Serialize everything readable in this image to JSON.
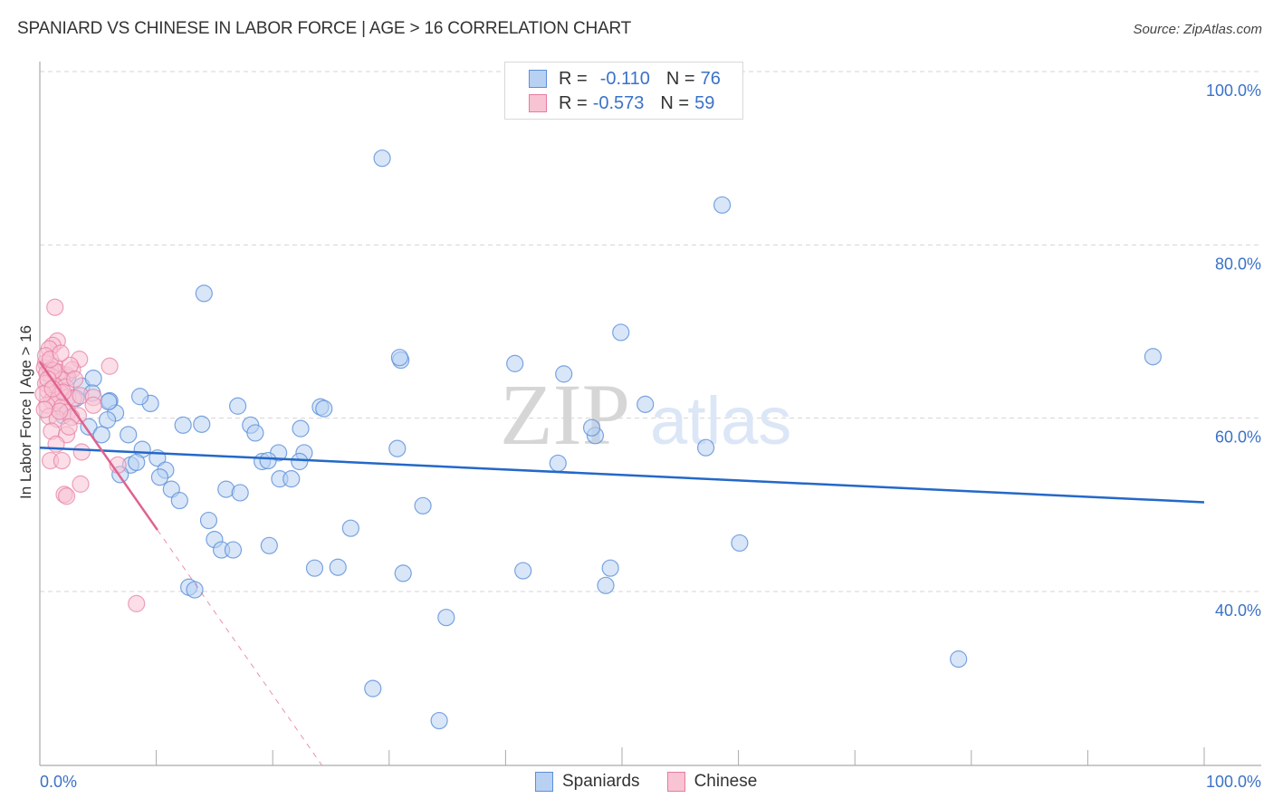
{
  "header": {
    "title": "SPANIARD VS CHINESE IN LABOR FORCE | AGE > 16 CORRELATION CHART",
    "source": "Source: ZipAtlas.com"
  },
  "legend": {
    "rows": [
      {
        "series": "Spaniards",
        "r_label": "R =",
        "r_value": "-0.110",
        "n_label": "N =",
        "n_value": "76"
      },
      {
        "series": "Chinese",
        "r_label": "R =",
        "r_value": "-0.573",
        "n_label": "N =",
        "n_value": "59"
      }
    ]
  },
  "bottom_legend": [
    "Spaniards",
    "Chinese"
  ],
  "watermark": {
    "zip": "ZIP",
    "atlas": "atlas"
  },
  "colors": {
    "spaniards_fill": "#b8d1f3",
    "spaniards_stroke": "#5b8fd9",
    "spaniards_line": "#2468c8",
    "chinese_fill": "#f8c3d3",
    "chinese_stroke": "#e57ca0",
    "chinese_line": "#e0628f",
    "axis_text": "#3a72c8"
  },
  "chart_data": {
    "type": "scatter",
    "title": "SPANIARD VS CHINESE IN LABOR FORCE | AGE > 16 CORRELATION CHART",
    "xlabel": "",
    "ylabel": "In Labor Force | Age > 16",
    "xlim": [
      0,
      100
    ],
    "ylim": [
      21.5,
      102.3
    ],
    "x_tick_labels": [
      "0.0%",
      "100.0%"
    ],
    "y_ticks": [
      40,
      60,
      80,
      100
    ],
    "y_tick_labels": [
      "40.0%",
      "60.0%",
      "80.0%",
      "100.0%"
    ],
    "grid": true,
    "legend_position": "top-center",
    "series": [
      {
        "name": "Spaniards",
        "R": -0.11,
        "N": 76,
        "trend": {
          "x": [
            0,
            100
          ],
          "y": [
            56.6,
            50.3
          ]
        },
        "points": [
          [
            29.4,
            90.0
          ],
          [
            58.6,
            84.6
          ],
          [
            14.1,
            74.4
          ],
          [
            49.9,
            69.9
          ],
          [
            95.6,
            67.1
          ],
          [
            31.0,
            66.7
          ],
          [
            40.8,
            66.3
          ],
          [
            45.0,
            65.1
          ],
          [
            3.6,
            63.7
          ],
          [
            4.6,
            64.6
          ],
          [
            4.5,
            62.9
          ],
          [
            6.0,
            62.0
          ],
          [
            9.5,
            61.7
          ],
          [
            17.0,
            61.4
          ],
          [
            24.1,
            61.3
          ],
          [
            24.4,
            61.1
          ],
          [
            52.0,
            61.6
          ],
          [
            6.5,
            60.6
          ],
          [
            5.8,
            59.8
          ],
          [
            4.2,
            59.0
          ],
          [
            12.3,
            59.2
          ],
          [
            13.9,
            59.3
          ],
          [
            18.1,
            59.2
          ],
          [
            18.5,
            58.3
          ],
          [
            7.6,
            58.1
          ],
          [
            5.3,
            58.1
          ],
          [
            8.8,
            56.4
          ],
          [
            30.7,
            56.5
          ],
          [
            47.7,
            58.0
          ],
          [
            47.4,
            58.9
          ],
          [
            57.2,
            56.6
          ],
          [
            20.5,
            56.0
          ],
          [
            22.7,
            56.0
          ],
          [
            22.3,
            55.0
          ],
          [
            19.1,
            55.0
          ],
          [
            19.6,
            55.1
          ],
          [
            7.8,
            54.6
          ],
          [
            10.1,
            55.4
          ],
          [
            8.3,
            54.9
          ],
          [
            44.5,
            54.8
          ],
          [
            10.8,
            54.0
          ],
          [
            6.9,
            53.5
          ],
          [
            10.3,
            53.2
          ],
          [
            20.6,
            53.0
          ],
          [
            21.6,
            53.0
          ],
          [
            11.3,
            51.8
          ],
          [
            16.0,
            51.8
          ],
          [
            17.2,
            51.4
          ],
          [
            12.0,
            50.5
          ],
          [
            32.9,
            49.9
          ],
          [
            14.5,
            48.2
          ],
          [
            26.7,
            47.3
          ],
          [
            15.0,
            46.0
          ],
          [
            15.6,
            44.8
          ],
          [
            16.6,
            44.8
          ],
          [
            19.7,
            45.3
          ],
          [
            60.1,
            45.6
          ],
          [
            23.6,
            42.7
          ],
          [
            25.6,
            42.8
          ],
          [
            31.2,
            42.1
          ],
          [
            41.5,
            42.4
          ],
          [
            49.0,
            42.7
          ],
          [
            48.6,
            40.7
          ],
          [
            12.8,
            40.5
          ],
          [
            13.3,
            40.2
          ],
          [
            34.9,
            37.0
          ],
          [
            78.9,
            32.2
          ],
          [
            28.6,
            28.8
          ],
          [
            34.3,
            25.1
          ],
          [
            2.4,
            64.7
          ],
          [
            3.1,
            62.3
          ],
          [
            2.0,
            60.3
          ],
          [
            8.6,
            62.5
          ],
          [
            5.9,
            61.9
          ],
          [
            30.9,
            67.0
          ],
          [
            22.4,
            58.8
          ]
        ]
      },
      {
        "name": "Chinese",
        "R": -0.573,
        "N": 59,
        "trend": {
          "x": [
            0,
            10.1
          ],
          "y": [
            66.5,
            47.1
          ]
        },
        "trend_dashed": {
          "x": [
            10.1,
            24.2
          ],
          "y": [
            47.1,
            20.0
          ]
        },
        "points": [
          [
            1.3,
            72.8
          ],
          [
            1.5,
            68.9
          ],
          [
            1.1,
            68.4
          ],
          [
            0.8,
            68.0
          ],
          [
            3.4,
            66.8
          ],
          [
            6.0,
            66.0
          ],
          [
            0.5,
            66.4
          ],
          [
            1.3,
            66.0
          ],
          [
            0.4,
            65.8
          ],
          [
            0.9,
            65.6
          ],
          [
            1.6,
            65.3
          ],
          [
            2.3,
            65.0
          ],
          [
            0.6,
            65.2
          ],
          [
            1.0,
            64.8
          ],
          [
            2.8,
            65.6
          ],
          [
            1.9,
            64.4
          ],
          [
            0.5,
            64.0
          ],
          [
            1.3,
            63.7
          ],
          [
            2.2,
            63.6
          ],
          [
            0.7,
            63.1
          ],
          [
            1.8,
            62.9
          ],
          [
            2.4,
            62.4
          ],
          [
            1.0,
            62.0
          ],
          [
            1.5,
            62.1
          ],
          [
            2.9,
            62.3
          ],
          [
            3.5,
            62.6
          ],
          [
            4.6,
            62.4
          ],
          [
            0.6,
            61.5
          ],
          [
            1.9,
            61.3
          ],
          [
            2.4,
            60.7
          ],
          [
            3.3,
            60.3
          ],
          [
            0.8,
            60.2
          ],
          [
            1.5,
            59.9
          ],
          [
            2.7,
            60.1
          ],
          [
            4.6,
            61.5
          ],
          [
            1.0,
            58.5
          ],
          [
            2.3,
            58.1
          ],
          [
            3.6,
            56.1
          ],
          [
            0.9,
            55.1
          ],
          [
            1.9,
            55.1
          ],
          [
            6.7,
            54.6
          ],
          [
            3.5,
            52.4
          ],
          [
            2.1,
            51.2
          ],
          [
            2.3,
            51.0
          ],
          [
            8.3,
            38.6
          ],
          [
            1.2,
            65.5
          ],
          [
            0.7,
            64.5
          ],
          [
            2.0,
            63.0
          ],
          [
            0.3,
            62.8
          ],
          [
            1.7,
            60.8
          ],
          [
            0.5,
            67.2
          ],
          [
            2.6,
            66.1
          ],
          [
            1.1,
            63.4
          ],
          [
            0.4,
            61.0
          ],
          [
            3.0,
            64.5
          ],
          [
            1.4,
            57.0
          ],
          [
            2.5,
            59.0
          ],
          [
            0.9,
            66.8
          ],
          [
            1.8,
            67.5
          ]
        ]
      }
    ]
  }
}
